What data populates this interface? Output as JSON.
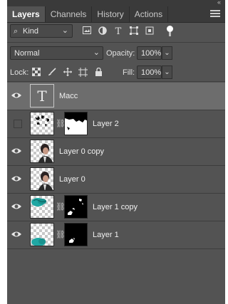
{
  "tabs": [
    "Layers",
    "Channels",
    "History",
    "Actions"
  ],
  "active_tab": "Layers",
  "filter": {
    "kind_label": "Kind",
    "icons": [
      "image-filter-icon",
      "adjustment-filter-icon",
      "type-filter-icon",
      "shape-filter-icon",
      "smart-object-filter-icon"
    ]
  },
  "blend": {
    "mode": "Normal",
    "opacity_label": "Opacity:",
    "opacity": "100%"
  },
  "lock": {
    "label": "Lock:",
    "fill_label": "Fill:",
    "fill": "100%"
  },
  "layers": [
    {
      "name": "Macc",
      "type": "text",
      "visible": true,
      "selected": true
    },
    {
      "name": "Layer 2",
      "type": "masked",
      "visible": false,
      "selected": false
    },
    {
      "name": "Layer 0 copy",
      "type": "photo",
      "visible": true,
      "selected": false
    },
    {
      "name": "Layer 0",
      "type": "photo",
      "visible": true,
      "selected": false
    },
    {
      "name": "Layer 1 copy",
      "type": "masked",
      "visible": true,
      "selected": false
    },
    {
      "name": "Layer 1",
      "type": "masked",
      "visible": true,
      "selected": false
    }
  ],
  "text_thumb_glyph": "T"
}
